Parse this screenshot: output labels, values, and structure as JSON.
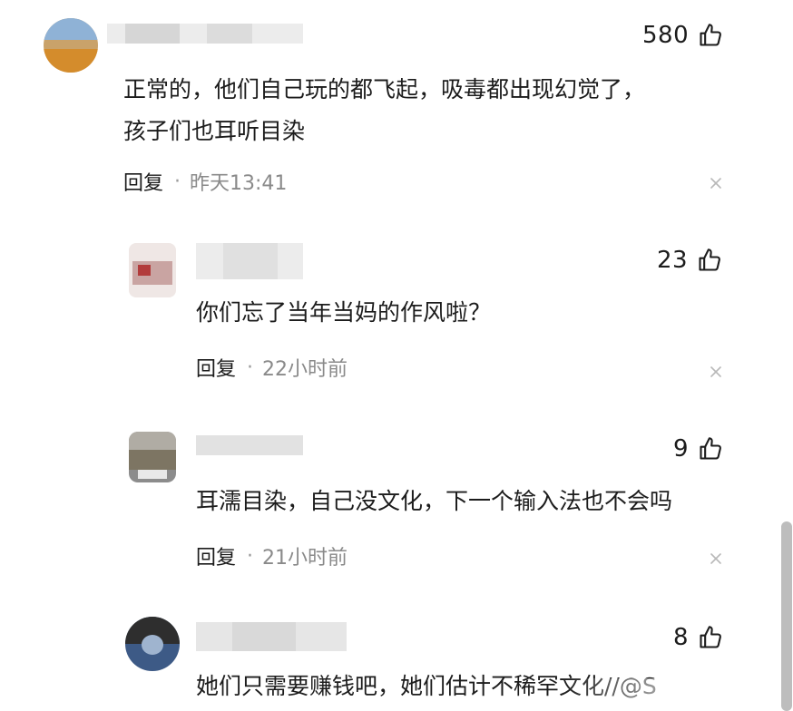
{
  "comments": [
    {
      "likes": "580",
      "text_lines": [
        "正常的，他们自己玩的都飞起，吸毒都出现幻觉了，",
        "孩子们也耳听目染"
      ],
      "reply_label": "回复",
      "separator": "·",
      "time": "昨天13:41"
    },
    {
      "likes": "23",
      "text_lines": [
        "你们忘了当年当妈的作风啦？"
      ],
      "reply_label": "回复",
      "separator": "·",
      "time": "22小时前"
    },
    {
      "likes": "9",
      "text_lines": [
        "耳濡目染，自己没文化，下一个输入法也不会吗"
      ],
      "reply_label": "回复",
      "separator": "·",
      "time": "21小时前"
    },
    {
      "likes": "8",
      "text_lines": [
        "她们只需要赚钱吧，她们估计不稀罕文化//@S"
      ]
    }
  ],
  "icons": {
    "like": "thumbs-up-icon",
    "close": "close-icon"
  },
  "colors": {
    "text": "#1c1c1c",
    "meta": "#8a8a8a",
    "scrollbar": "#bdbdbd"
  }
}
